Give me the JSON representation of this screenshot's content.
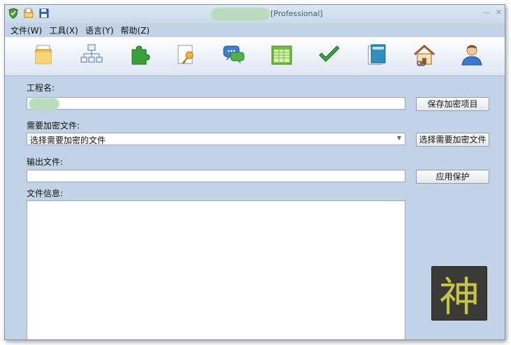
{
  "window": {
    "title": "[Professional]"
  },
  "menu": [
    {
      "label": "文件(W)"
    },
    {
      "label": "工具(X)"
    },
    {
      "label": "语言(Y)"
    },
    {
      "label": "帮助(Z)"
    }
  ],
  "toolbar_icons": [
    "new-project-icon",
    "network-icon",
    "plugin-icon",
    "key-document-icon",
    "chat-icon",
    "spreadsheet-icon",
    "checkmark-icon",
    "book-icon",
    "house-icon",
    "user-icon"
  ],
  "form": {
    "project_name_label": "工程名:",
    "project_name_value": "",
    "save_button": "保存加密项目",
    "encrypt_file_label": "需要加密文件:",
    "encrypt_file_value": "选择需要加密的文件",
    "select_file_button": "选择需要加密文件",
    "output_label": "输出文件:",
    "output_value": "",
    "apply_button": "应用保护",
    "file_info_label": "文件信息:"
  },
  "logo_char": "神",
  "window_controls": {
    "minimize": "—",
    "close": "✕"
  }
}
